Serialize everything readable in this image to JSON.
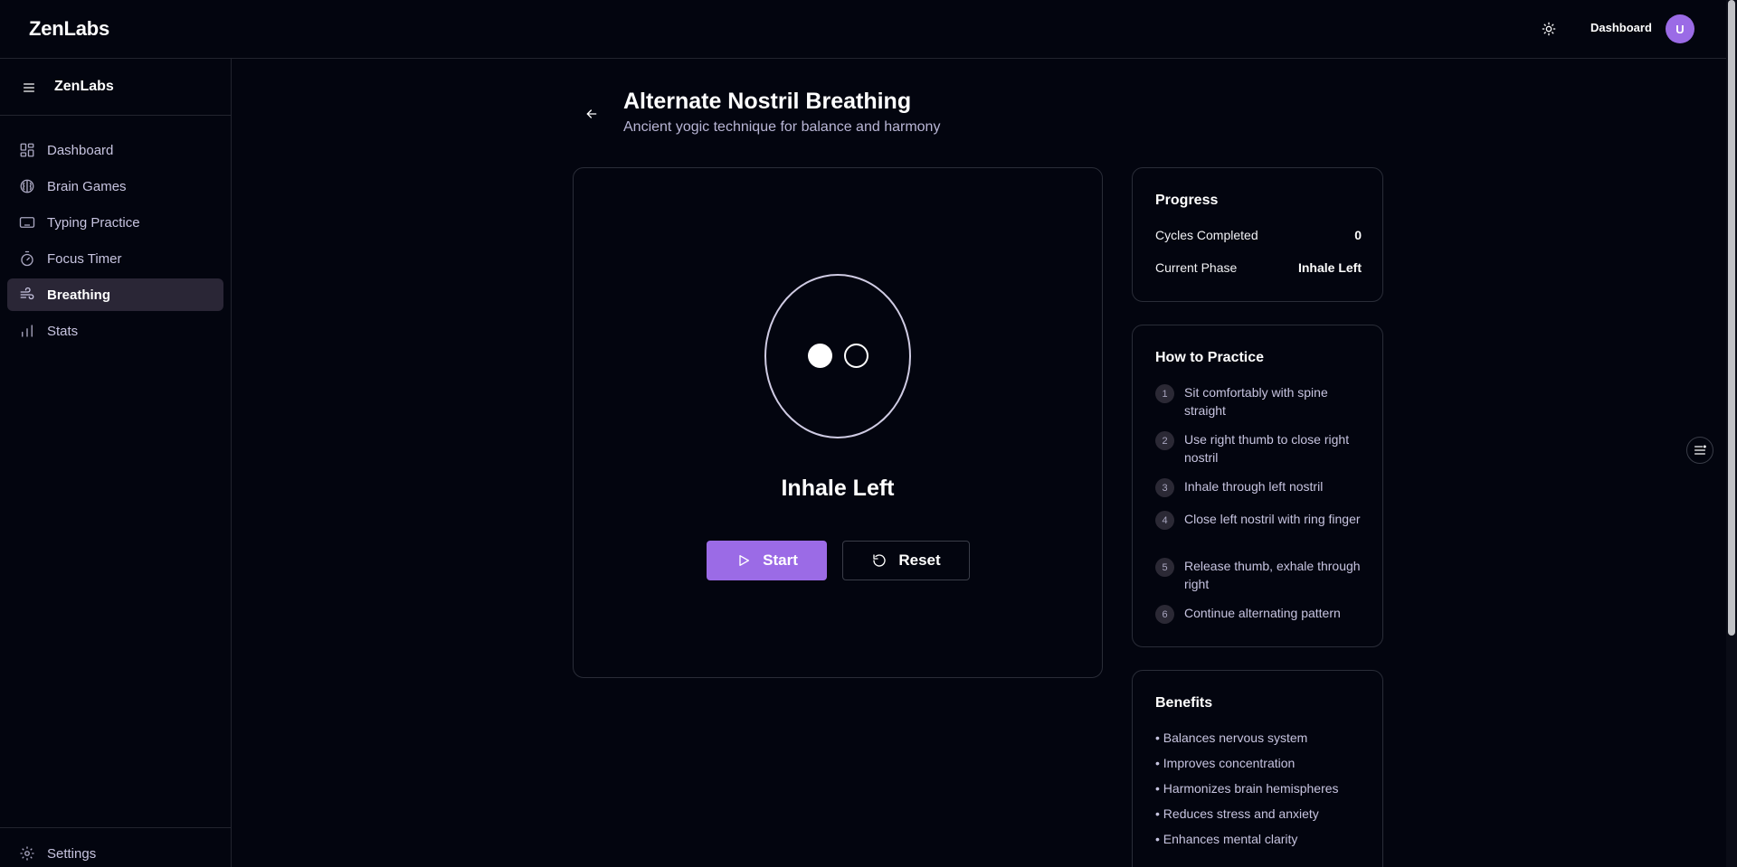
{
  "header": {
    "brand": "ZenLabs",
    "dashboard_link": "Dashboard",
    "avatar_initial": "U",
    "theme_icon": "sun-icon"
  },
  "sidebar": {
    "brand": "ZenLabs",
    "menu_icon": "hamburger-icon",
    "items": [
      {
        "label": "Dashboard",
        "icon": "grid-icon",
        "active": false
      },
      {
        "label": "Brain Games",
        "icon": "brain-icon",
        "active": false
      },
      {
        "label": "Typing Practice",
        "icon": "keyboard-icon",
        "active": false
      },
      {
        "label": "Focus Timer",
        "icon": "timer-icon",
        "active": false
      },
      {
        "label": "Breathing",
        "icon": "wind-icon",
        "active": true
      },
      {
        "label": "Stats",
        "icon": "bar-chart-icon",
        "active": false
      }
    ],
    "settings_label": "Settings"
  },
  "page": {
    "title": "Alternate Nostril Breathing",
    "subtitle": "Ancient yogic technique for balance and harmony"
  },
  "exercise": {
    "phase": "Inhale Left",
    "start_label": "Start",
    "reset_label": "Reset"
  },
  "progress": {
    "title": "Progress",
    "cycles_label": "Cycles Completed",
    "cycles_value": "0",
    "phase_label": "Current Phase",
    "phase_value": "Inhale Left"
  },
  "how_to": {
    "title": "How to Practice",
    "steps": [
      {
        "num": "1",
        "text": "Sit comfortably with spine straight"
      },
      {
        "num": "2",
        "text": "Use right thumb to close right nostril"
      },
      {
        "num": "3",
        "text": "Inhale through left nostril"
      },
      {
        "num": "4",
        "text": "Close left nostril with ring finger"
      },
      {
        "num": "5",
        "text": "Release thumb, exhale through right"
      },
      {
        "num": "6",
        "text": "Continue alternating pattern"
      }
    ]
  },
  "benefits": {
    "title": "Benefits",
    "items": [
      "• Balances nervous system",
      "• Improves concentration",
      "• Harmonizes brain hemispheres",
      "• Reduces stress and anxiety",
      "• Enhances mental clarity"
    ]
  },
  "colors": {
    "background": "#03050f",
    "accent": "#9b6be6",
    "active_nav": "#2a2636",
    "border": "#2a2d38"
  }
}
